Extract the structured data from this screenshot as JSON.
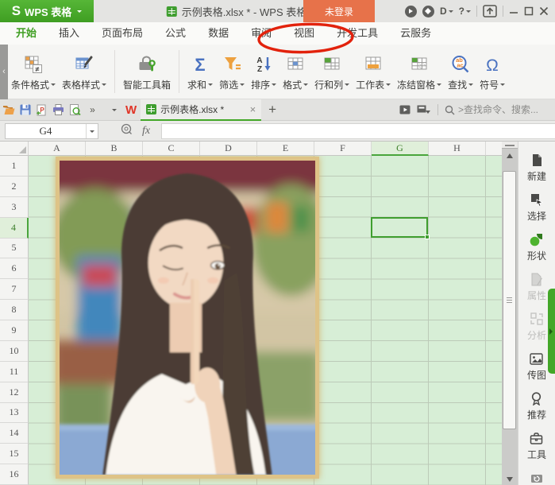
{
  "titlebar": {
    "logo_glyph": "S",
    "logo_label": "WPS 表格",
    "doc_title": "示例表格.xlsx * - WPS 表格",
    "login_label": "未登录",
    "d_badge": "D",
    "help_glyph": "?"
  },
  "menu": {
    "tabs": [
      {
        "label": "开始",
        "active": true
      },
      {
        "label": "插入"
      },
      {
        "label": "页面布局"
      },
      {
        "label": "公式"
      },
      {
        "label": "数据"
      },
      {
        "label": "审阅"
      },
      {
        "label": "视图",
        "annotated": true
      },
      {
        "label": "开发工具"
      },
      {
        "label": "云服务"
      }
    ],
    "annotation": "red ellipse around 视图"
  },
  "ribbon": {
    "collapse_glyph": "‹",
    "items": [
      {
        "label": "条件格式",
        "dropdown": true
      },
      {
        "label": "表格样式",
        "dropdown": true
      },
      {
        "label": "智能工具箱",
        "dropdown": false
      },
      {
        "label": "求和",
        "dropdown": true
      },
      {
        "label": "筛选",
        "dropdown": true
      },
      {
        "label": "排序",
        "dropdown": true
      },
      {
        "label": "格式",
        "dropdown": true
      },
      {
        "label": "行和列",
        "dropdown": true
      },
      {
        "label": "工作表",
        "dropdown": true
      },
      {
        "label": "冻结窗格",
        "dropdown": true
      },
      {
        "label": "查找",
        "dropdown": true
      },
      {
        "label": "符号",
        "dropdown": true
      }
    ],
    "glyphs": {
      "sigma": "Σ",
      "omega": "Ω",
      "not_equal": "≠",
      "sort_a": "A",
      "sort_z": "Z",
      "find_ab": "ab",
      "find_ac": "ac"
    }
  },
  "tabbar": {
    "more_glyph": "»",
    "wps_w": "W",
    "doc_tab_label": "示例表格.xlsx *",
    "tab_close_glyph": "×",
    "new_tab_glyph": "+",
    "search_placeholder": ">查找命令、搜索..."
  },
  "formula_bar": {
    "cell_ref": "G4",
    "fx_label": "fx"
  },
  "grid": {
    "columns": [
      "A",
      "B",
      "C",
      "D",
      "E",
      "F",
      "G",
      "H"
    ],
    "rows": [
      "1",
      "2",
      "3",
      "4",
      "5",
      "6",
      "7",
      "8",
      "9",
      "10",
      "11",
      "12",
      "13",
      "14",
      "15",
      "16"
    ],
    "selected_cell": "G4",
    "selected_column": "G",
    "selected_row": "4"
  },
  "sidebar": {
    "items": [
      {
        "label": "新建"
      },
      {
        "label": "选择"
      },
      {
        "label": "形状"
      },
      {
        "label": "属性",
        "disabled": true
      },
      {
        "label": "分析",
        "disabled": true
      },
      {
        "label": "传图"
      },
      {
        "label": "推荐"
      },
      {
        "label": "工具"
      }
    ]
  },
  "colors": {
    "brand_green": "#43a728",
    "login_orange": "#e7724a",
    "sheet_green": "#d7eed6",
    "annotation_red": "#e2220c",
    "selection_green": "#3f9e2f"
  }
}
